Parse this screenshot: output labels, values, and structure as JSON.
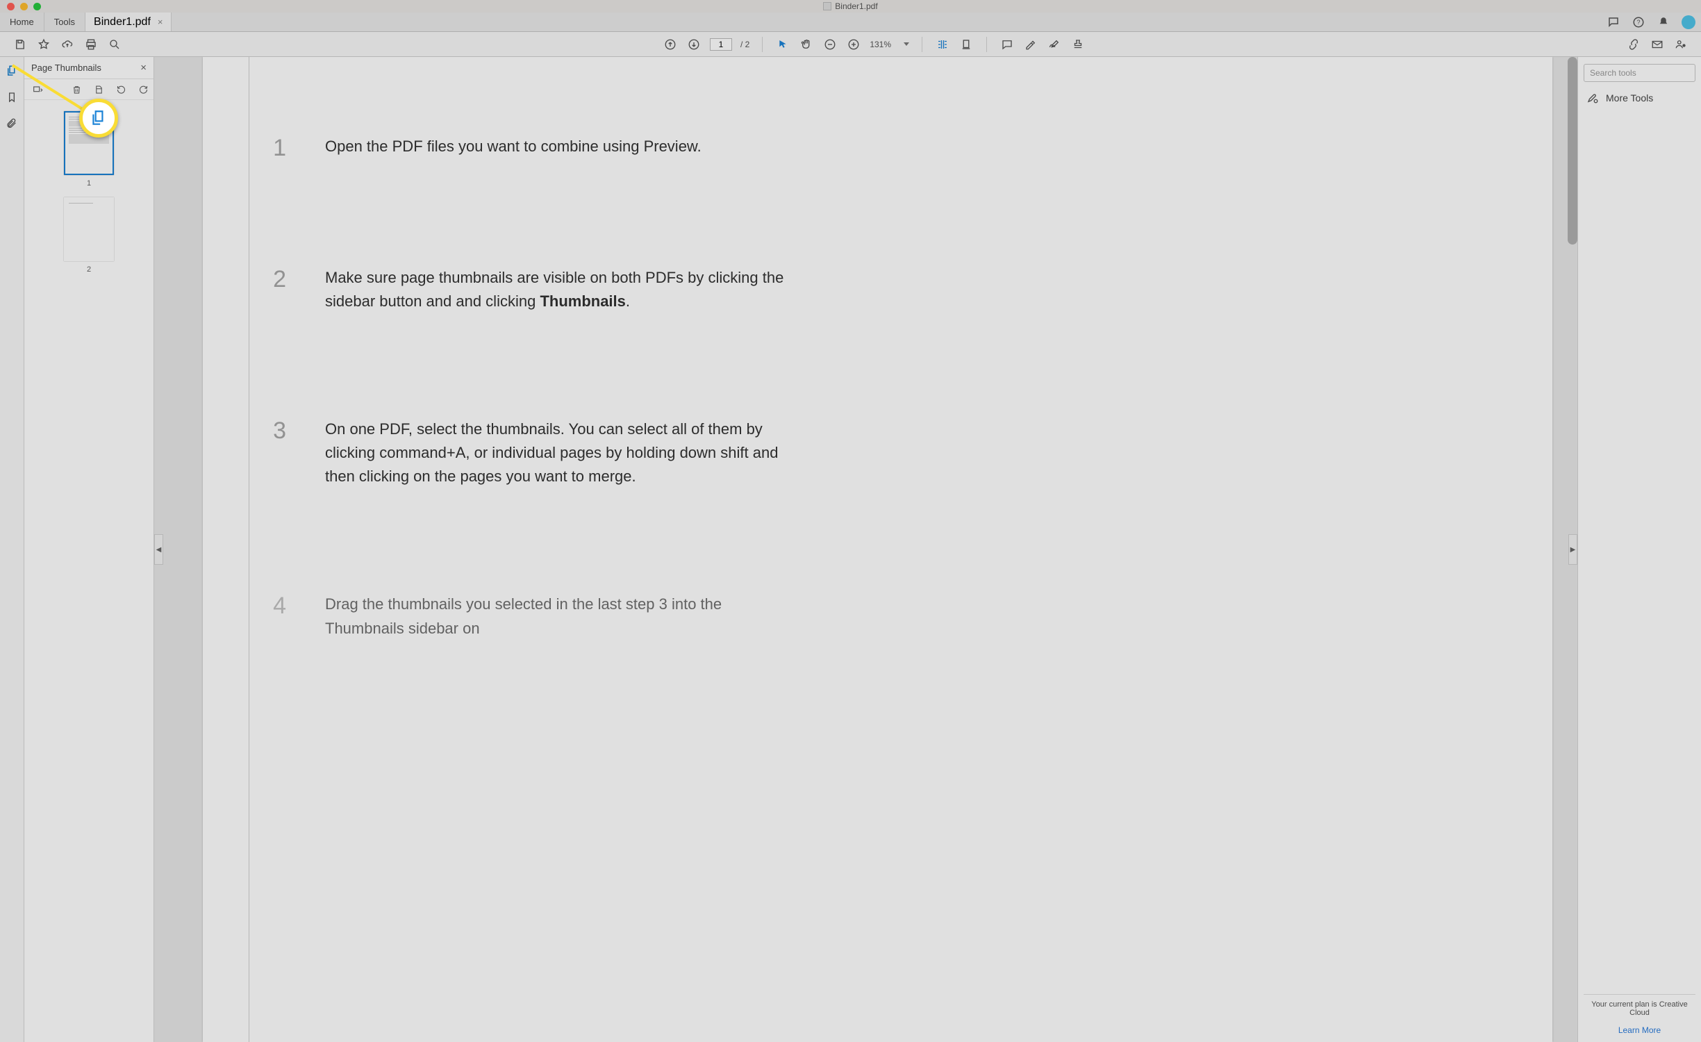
{
  "window": {
    "title": "Binder1.pdf"
  },
  "tabs": {
    "home": "Home",
    "tools": "Tools",
    "document": "Binder1.pdf"
  },
  "toolbar": {
    "page_current": "1",
    "page_total": "/ 2",
    "zoom": "131%"
  },
  "thumbnails": {
    "title": "Page Thumbnails",
    "pages": [
      "1",
      "2"
    ]
  },
  "document": {
    "steps": [
      {
        "num": "1",
        "text": "Open the PDF files you want to combine using Preview."
      },
      {
        "num": "2",
        "text_pre": "Make sure page thumbnails are visible on both PDFs by clicking the sidebar button and and clicking ",
        "bold": "Thumbnails",
        "text_post": "."
      },
      {
        "num": "3",
        "text": "On one PDF, select the thumbnails. You can select all of them by clicking command+A, or individual pages by holding down shift and then clicking on the pages you want to merge."
      },
      {
        "num": "4",
        "text": "Drag the thumbnails you selected in the last step 3 into the Thumbnails sidebar on"
      }
    ]
  },
  "rightpanel": {
    "search_placeholder": "Search tools",
    "more_tools": "More Tools",
    "plan_text": "Your current plan is Creative Cloud",
    "learn_more": "Learn More"
  }
}
